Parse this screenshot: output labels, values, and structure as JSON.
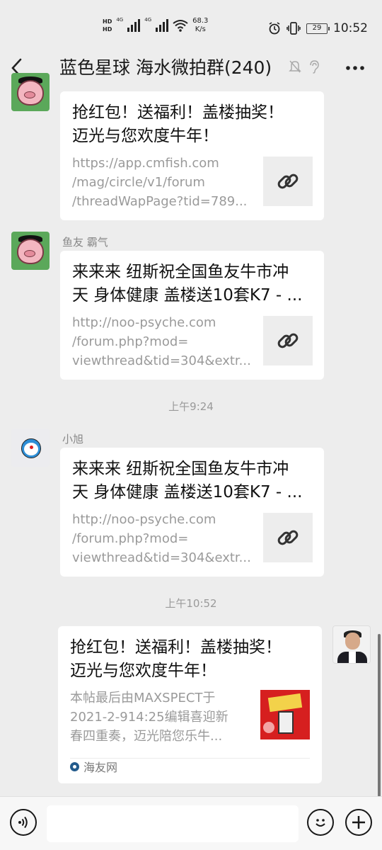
{
  "status_bar": {
    "hd1": "HD",
    "hd2": "HD",
    "net1": "4G",
    "net2": "4G",
    "speed_value": "68.3",
    "speed_unit": "K/s",
    "battery": "29",
    "time": "10:52",
    "icons": [
      "alarm-icon",
      "vibrate-icon",
      "battery-icon",
      "wifi-icon",
      "signal-icon"
    ]
  },
  "header": {
    "back_icon": "‹",
    "title": "蓝色星球 海水微拍群(240)",
    "mute_icon": "bell-off-icon",
    "ear_icon": "ear-icon",
    "more_icon": "···"
  },
  "messages": [
    {
      "sender": "",
      "title_lines": [
        "抢红包！送福利！盖楼抽奖！",
        "迈光与您欢度牛年！"
      ],
      "url_lines": [
        "https://app.cmfish.com",
        "/mag/circle/v1/forum",
        "/threadWapPage?tid=789..."
      ]
    },
    {
      "sender": "鱼友 霸气",
      "title_lines": [
        "来来来 纽斯祝全国鱼友牛市冲",
        "天 身体健康 盖楼送10套K7 - ..."
      ],
      "url_lines": [
        "http://noo-psyche.com",
        "/forum.php?mod=",
        "viewthread&tid=304&extr..."
      ]
    },
    {
      "time": "上午9:24",
      "sender": "小旭",
      "title_lines": [
        "来来来 纽斯祝全国鱼友牛市冲",
        "天 身体健康 盖楼送10套K7 - ..."
      ],
      "url_lines": [
        "http://noo-psyche.com",
        "/forum.php?mod=",
        "viewthread&tid=304&extr..."
      ]
    },
    {
      "time": "上午10:52",
      "title_lines": [
        "抢红包！送福利！盖楼抽奖！",
        "迈光与您欢度牛年！"
      ],
      "desc_lines": [
        "本帖最后由MAXSPECT于",
        "2021-2-914:25编辑喜迎新",
        "春四重奏，迈光陪您乐牛..."
      ],
      "source": "海友网"
    }
  ],
  "input_bar": {
    "voice_icon": "voice-icon",
    "emoji_icon": "emoji-icon",
    "plus_icon": "plus-icon",
    "input_value": ""
  }
}
